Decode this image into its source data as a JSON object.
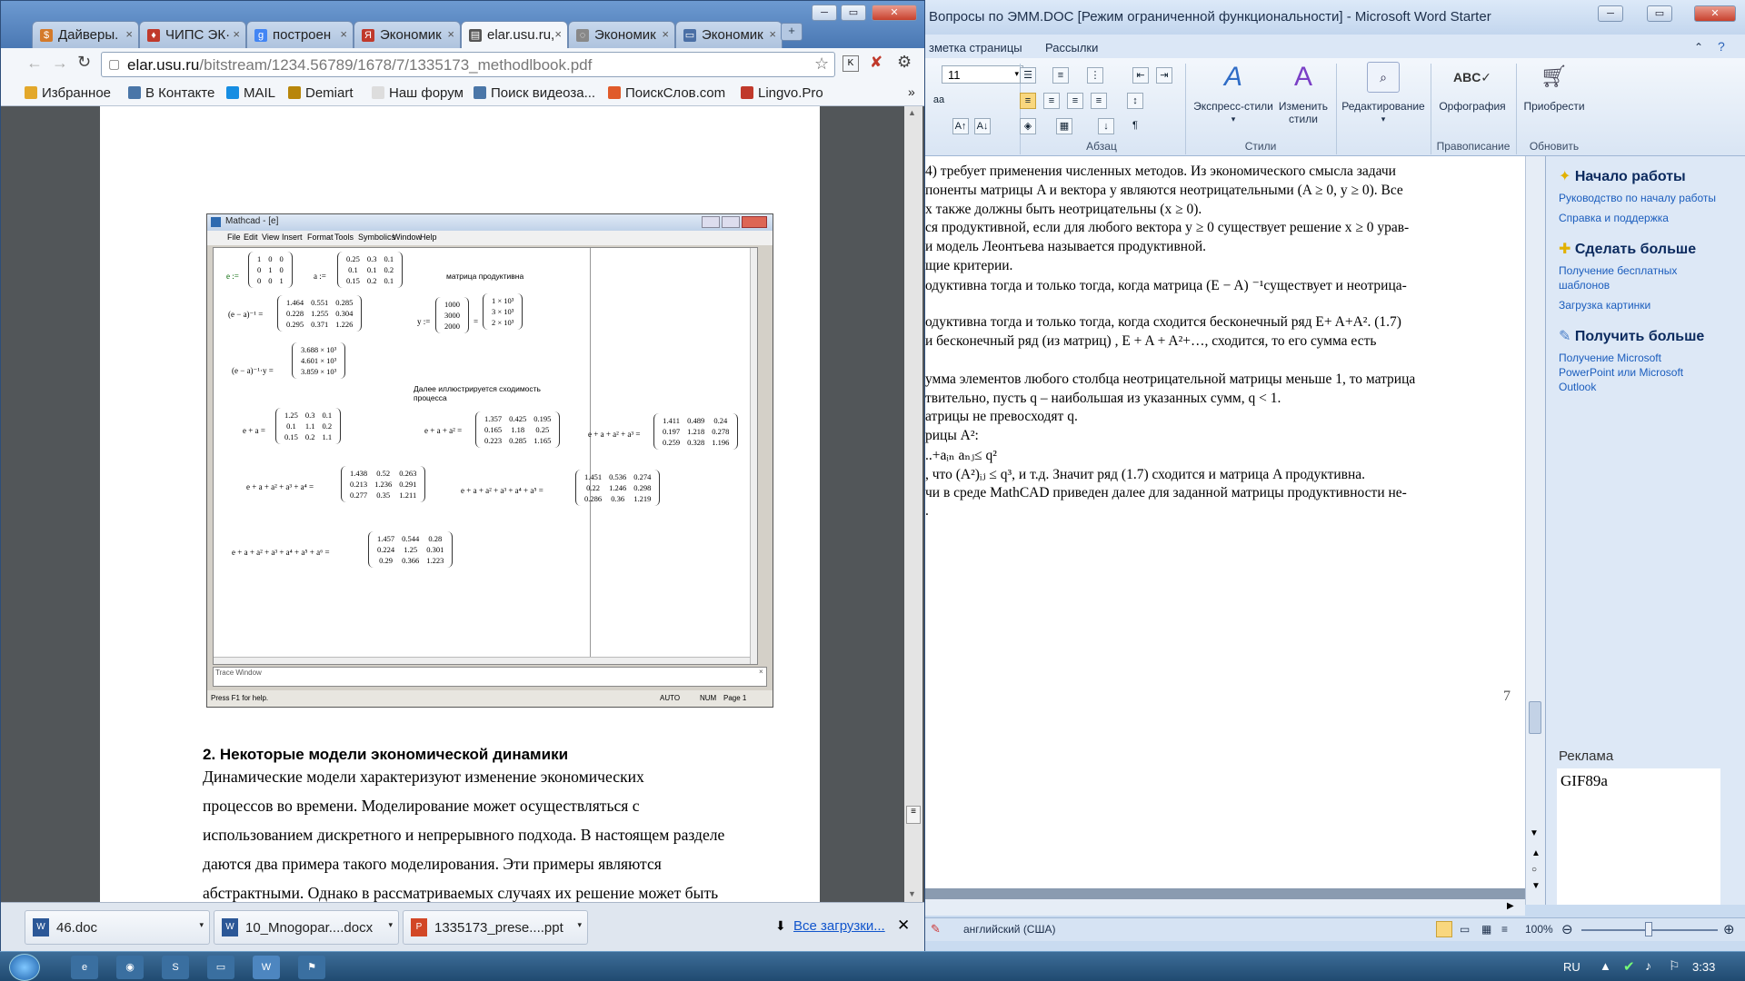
{
  "word": {
    "title": "Вопросы по ЭММ.DOC [Режим ограниченной функциональности] - Microsoft Word Starter",
    "tabs": [
      "зметка страницы",
      "Рассылки"
    ],
    "font_size": "11",
    "groups": {
      "paragraph": "Абзац",
      "styles": "Стили",
      "proofing": "Правописание",
      "upgrade": "Обновить"
    },
    "buttons": {
      "quick_styles": "Экспресс-стили",
      "change_styles_1": "Изменить",
      "change_styles_2": "стили",
      "editing": "Редактирование",
      "spelling": "Орфография",
      "acquire": "Приобрести"
    },
    "doc_lines": [
      "4) требует применения численных методов. Из экономического смысла задачи",
      "поненты матрицы A и вектора y являются неотрицательными  (A ≥ 0, y ≥ 0).  Все",
      "х также должны быть неотрицательны  (x ≥ 0).",
      "ся продуктивной,  если для любого вектора y ≥ 0 существует решение x ≥ 0 урав-",
      "и модель Леонтьева называется продуктивной.",
      "щие  критерии.",
      "одуктивна тогда и только тогда, когда матрица (E − A) ⁻¹существует и неотрица-",
      "",
      "одуктивна тогда и только тогда,  когда сходится бесконечный ряд E+ A+A². (1.7)",
      "и бесконечный ряд (из матриц) , E + A + A²+…, сходится,  то его сумма  есть",
      "",
      "умма элементов любого столбца неотрицательной матрицы меньше 1, то матрица",
      "твительно, пусть q – наибольшая из указанных сумм, q < 1.",
      "атрицы не превосходят q.",
      "рицы A²:",
      "..+aᵢₙ aₙⱼ≤ q²",
      ",  что (A²)ᵢⱼ ≤ q³,  и т.д.  Значит ряд (1.7)  сходится и матрица A продуктивна.",
      "чи в среде MathCAD приведен далее для заданной матрицы продуктивности не-",
      "."
    ],
    "page_number": "7",
    "taskpane": {
      "h1": "Начало работы",
      "l1": "Руководство по началу работы",
      "l2": "Справка и поддержка",
      "h2": "Сделать больше",
      "l3a": "Получение бесплатных",
      "l3b": "шаблонов",
      "l4": "Загрузка картинки",
      "h3": "Получить больше",
      "l5a": "Получение Microsoft",
      "l5b": "PowerPoint или Microsoft",
      "l5c": "Outlook",
      "ad_label": "Реклама",
      "ad_text": "GIF89a"
    },
    "status": {
      "language": "английский (США)",
      "zoom": "100%"
    }
  },
  "chrome": {
    "tabs": [
      {
        "label": "Дайверы.",
        "color": "#d47a2a",
        "glyph": "$"
      },
      {
        "label": "ЧИПС ЭК·",
        "color": "#c0392b",
        "glyph": "♦"
      },
      {
        "label": "построен",
        "color": "#4285f4",
        "glyph": "g"
      },
      {
        "label": "Экономик",
        "color": "#c0392b",
        "glyph": "Я"
      },
      {
        "label": "elar.usu.ru,",
        "color": "#555555",
        "glyph": "▤"
      },
      {
        "label": "Экономик",
        "color": "#888888",
        "glyph": "◌"
      },
      {
        "label": "Экономик",
        "color": "#4a6fa5",
        "glyph": "▭"
      }
    ],
    "url_host": "elar.usu.ru",
    "url_path": "/bitstream/1234.56789/1678/7/1335173_methodlbook.pdf",
    "bookmarks": [
      {
        "label": "Избранное",
        "color": "#e3a82b"
      },
      {
        "label": "В Контакте",
        "color": "#4a76a8"
      },
      {
        "label": "MAIL",
        "color": "#168de2"
      },
      {
        "label": "Demiart",
        "color": "#b8860b"
      },
      {
        "label": "Наш форум",
        "color": "#dddddd"
      },
      {
        "label": "Поиск видеоза...",
        "color": "#4a76a8"
      },
      {
        "label": "ПоискСлов.com",
        "color": "#e05a2a"
      },
      {
        "label": "Lingvo.Pro",
        "color": "#c0392b"
      }
    ],
    "downloads": [
      {
        "label": "46.doc",
        "color": "#2b5797",
        "glyph": "W"
      },
      {
        "label": "10_Mnogopar....docx",
        "color": "#2b5797",
        "glyph": "W"
      },
      {
        "label": "1335173_prese....ppt",
        "color": "#d24726",
        "glyph": "P"
      }
    ],
    "all_downloads": "Все загрузки..."
  },
  "mathcad": {
    "title": "Mathcad - [e]",
    "menu": [
      "File",
      "Edit",
      "View",
      "Insert",
      "Format",
      "Tools",
      "Symbolics",
      "Window",
      "Help"
    ],
    "e_label": "e :=",
    "a_label": "a :=",
    "note1": "матрица продуктивна",
    "inv_label": "(e − a)⁻¹ =",
    "y_label": "y :=",
    "prod_label": "(e − a)⁻¹·y =",
    "note2a": "Далее иллюстрируется сходимость",
    "note2b": "процесса",
    "s1_label": "e + a =",
    "s2_label": "e + a + a² =",
    "s3_label": "e + a + a² + a³ =",
    "s4_label": "e + a + a² + a³ + a⁴ =",
    "s5_label": "e + a + a² + a³ + a⁴ + a⁵ =",
    "s6_label": "e + a + a² + a³ + a⁴ + a⁵ + a⁶ =",
    "e": [
      [
        "1",
        "0",
        "0"
      ],
      [
        "0",
        "1",
        "0"
      ],
      [
        "0",
        "0",
        "1"
      ]
    ],
    "a": [
      [
        "0.25",
        "0.3",
        "0.1"
      ],
      [
        "0.1",
        "0.1",
        "0.2"
      ],
      [
        "0.15",
        "0.2",
        "0.1"
      ]
    ],
    "inv": [
      [
        "1.464",
        "0.551",
        "0.285"
      ],
      [
        "0.228",
        "1.255",
        "0.304"
      ],
      [
        "0.295",
        "0.371",
        "1.226"
      ]
    ],
    "y": [
      [
        "1000"
      ],
      [
        "3000"
      ],
      [
        "2000"
      ]
    ],
    "y_sci": [
      [
        "1 × 10³"
      ],
      [
        "3 × 10³"
      ],
      [
        "2 × 10³"
      ]
    ],
    "prod": [
      [
        "3.688 × 10³"
      ],
      [
        "4.601 × 10³"
      ],
      [
        "3.859 × 10³"
      ]
    ],
    "s1": [
      [
        "1.25",
        "0.3",
        "0.1"
      ],
      [
        "0.1",
        "1.1",
        "0.2"
      ],
      [
        "0.15",
        "0.2",
        "1.1"
      ]
    ],
    "s2": [
      [
        "1.357",
        "0.425",
        "0.195"
      ],
      [
        "0.165",
        "1.18",
        "0.25"
      ],
      [
        "0.223",
        "0.285",
        "1.165"
      ]
    ],
    "s3": [
      [
        "1.411",
        "0.489",
        "0.24"
      ],
      [
        "0.197",
        "1.218",
        "0.278"
      ],
      [
        "0.259",
        "0.328",
        "1.196"
      ]
    ],
    "s4": [
      [
        "1.438",
        "0.52",
        "0.263"
      ],
      [
        "0.213",
        "1.236",
        "0.291"
      ],
      [
        "0.277",
        "0.35",
        "1.211"
      ]
    ],
    "s5": [
      [
        "1.451",
        "0.536",
        "0.274"
      ],
      [
        "0.22",
        "1.246",
        "0.298"
      ],
      [
        "0.286",
        "0.36",
        "1.219"
      ]
    ],
    "s6": [
      [
        "1.457",
        "0.544",
        "0.28"
      ],
      [
        "0.224",
        "1.25",
        "0.301"
      ],
      [
        "0.29",
        "0.366",
        "1.223"
      ]
    ],
    "trace": "Trace Window",
    "status_help": "Press F1 for help.",
    "status_auto": "AUTO",
    "status_num": "NUM",
    "status_page": "Page 1"
  },
  "pdf": {
    "heading": "2. Некоторые модели экономической динамики",
    "lines": [
      "       Динамические   модели   характеризуют   изменение   экономических",
      "процессов    во    времени.    Моделирование    может    осуществляться    с",
      "использованием дискретного и непрерывного подхода. В настоящем разделе",
      "даются   два   примера   такого   моделирования.   Эти   примеры   являются",
      "абстрактными. Однако в рассматриваемых случаях их решение может быть"
    ]
  },
  "taskbar": {
    "lang": "RU",
    "time": "3:33"
  }
}
